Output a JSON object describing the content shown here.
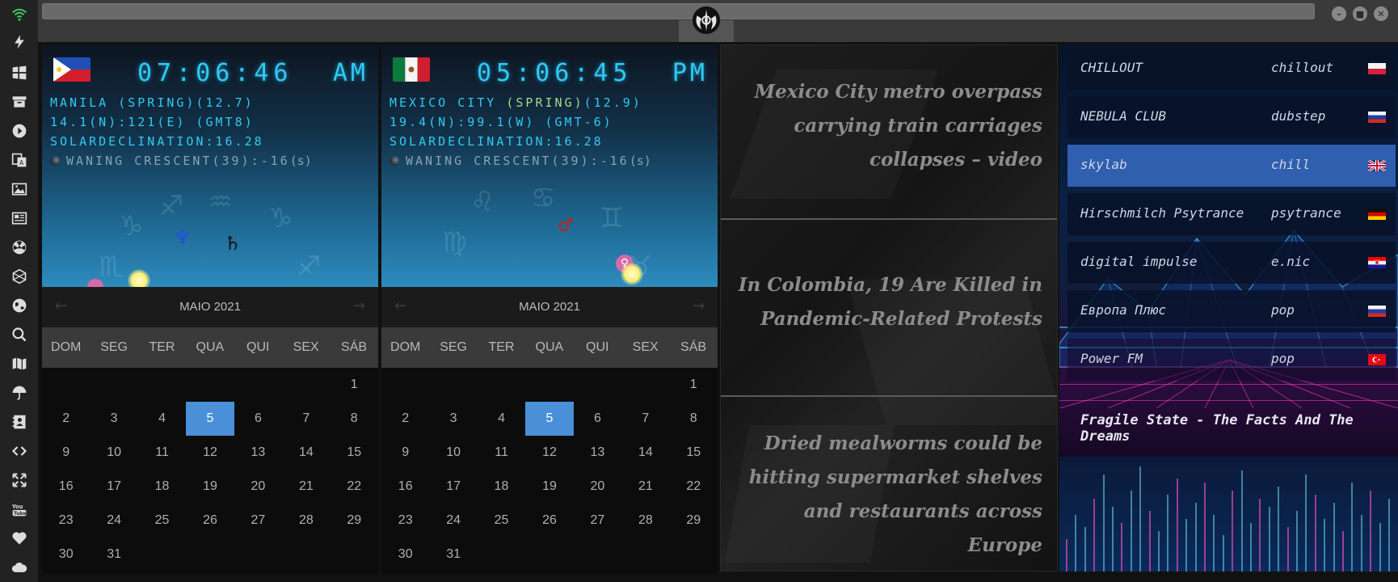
{
  "sidebar": {
    "icons": [
      "wifi-icon",
      "bolt-icon",
      "windows-icon",
      "archive-icon",
      "play-icon",
      "translate-icon",
      "image-icon",
      "news-icon",
      "radiation-icon",
      "hexagon-icon",
      "globe-icon",
      "search-icon",
      "map-icon",
      "umbrella-icon",
      "contacts-icon",
      "code-icon",
      "expand-icon",
      "youtube-icon",
      "heart-icon",
      "cloud-icon"
    ]
  },
  "clocks": [
    {
      "time": "07:06:46",
      "ampm": "AM",
      "city_line": "MANILA (SPRING)(12.7)",
      "coords_line": "14.1(N):121(E) (GMT8)",
      "solar_line": "SOLARDECLINATION:16.28",
      "moon_line": "WANING CRESCENT(39):-16",
      "moon_suffix": "(s)",
      "flag": "philippines"
    },
    {
      "time": "05:06:45",
      "ampm": "PM",
      "city_name": "MEXICO CITY ",
      "city_season": "(SPRING)",
      "city_value": "(12.9)",
      "coords_line": "19.4(N):99.1(W) (GMT-6)",
      "solar_line": "SOLARDECLINATION:16.28",
      "moon_line": "WANING CRESCENT(39):-16",
      "moon_suffix": "(s)",
      "flag": "mexico"
    }
  ],
  "calendars": [
    {
      "title": "MAIO 2021",
      "prev": "←",
      "next": "→",
      "weekdays": [
        "DOM",
        "SEG",
        "TER",
        "QUA",
        "QUI",
        "SEX",
        "SÁB"
      ],
      "first_weekday": 6,
      "days_in_month": 31,
      "today": 5
    },
    {
      "title": "MAIO 2021",
      "prev": "←",
      "next": "→",
      "weekdays": [
        "DOM",
        "SEG",
        "TER",
        "QUA",
        "QUI",
        "SEX",
        "SÁB"
      ],
      "first_weekday": 6,
      "days_in_month": 31,
      "today": 5
    }
  ],
  "news": [
    "Mexico City metro overpass carrying train carriages collapses – video",
    "In Colombia, 19 Are Killed in Pandemic-Related Protests",
    "Dried mealworms could be hitting supermarket shelves and restaurants across Europe"
  ],
  "radio": {
    "stations": [
      {
        "name": "CHILLOUT",
        "genre": "chillout",
        "flag": "poland"
      },
      {
        "name": "NEBULA CLUB",
        "genre": "dubstep",
        "flag": "russia"
      },
      {
        "name": "skylab",
        "genre": "chill",
        "flag": "uk",
        "active": true
      },
      {
        "name": "Hirschmilch Psytrance",
        "genre": "psytrance",
        "flag": "germany"
      },
      {
        "name": "digital impulse",
        "genre": "e.nic",
        "flag": "croatia"
      },
      {
        "name": "Европа Плюс",
        "genre": "pop",
        "flag": "russia"
      },
      {
        "name": "Power FM",
        "genre": "pop",
        "flag": "turkey"
      }
    ],
    "now_playing": "Fragile State - The Facts And The Dreams"
  },
  "window_controls": [
    "minimize-icon",
    "maximize-icon",
    "close-icon"
  ],
  "colors": {
    "clock_cyan": "#31c9f2",
    "today_highlight": "#4a90d9",
    "active_station": "#2f5fae"
  }
}
